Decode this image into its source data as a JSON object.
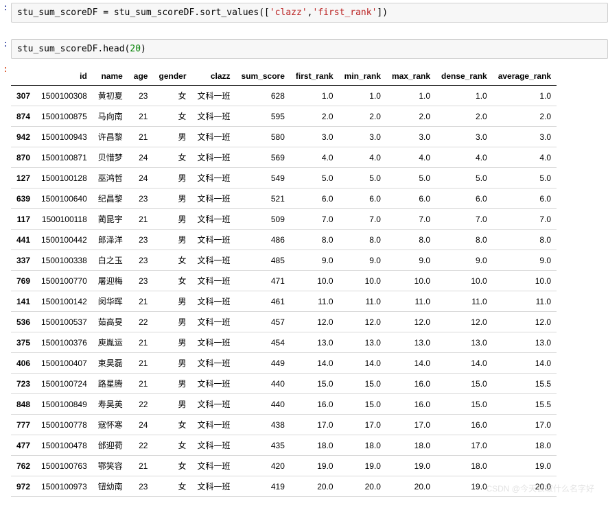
{
  "cells": {
    "code1": {
      "prompt": ":",
      "code_plain": "stu_sum_scoreDF = stu_sum_scoreDF.sort_values([",
      "str1": "'clazz'",
      "comma": ",",
      "str2": "'first_rank'",
      "end": "])"
    },
    "code2": {
      "prompt": ":",
      "code_plain": "stu_sum_scoreDF.head(",
      "num": "20",
      "end": ")"
    },
    "out_prompt": ":"
  },
  "table": {
    "columns": [
      "",
      "id",
      "name",
      "age",
      "gender",
      "clazz",
      "sum_score",
      "first_rank",
      "min_rank",
      "max_rank",
      "dense_rank",
      "average_rank"
    ],
    "rows": [
      {
        "idx": "307",
        "id": "1500100308",
        "name": "黄初夏",
        "age": "23",
        "gender": "女",
        "clazz": "文科一班",
        "sum_score": "628",
        "first_rank": "1.0",
        "min_rank": "1.0",
        "max_rank": "1.0",
        "dense_rank": "1.0",
        "average_rank": "1.0"
      },
      {
        "idx": "874",
        "id": "1500100875",
        "name": "马向南",
        "age": "21",
        "gender": "女",
        "clazz": "文科一班",
        "sum_score": "595",
        "first_rank": "2.0",
        "min_rank": "2.0",
        "max_rank": "2.0",
        "dense_rank": "2.0",
        "average_rank": "2.0"
      },
      {
        "idx": "942",
        "id": "1500100943",
        "name": "许昌黎",
        "age": "21",
        "gender": "男",
        "clazz": "文科一班",
        "sum_score": "580",
        "first_rank": "3.0",
        "min_rank": "3.0",
        "max_rank": "3.0",
        "dense_rank": "3.0",
        "average_rank": "3.0"
      },
      {
        "idx": "870",
        "id": "1500100871",
        "name": "贝惜梦",
        "age": "24",
        "gender": "女",
        "clazz": "文科一班",
        "sum_score": "569",
        "first_rank": "4.0",
        "min_rank": "4.0",
        "max_rank": "4.0",
        "dense_rank": "4.0",
        "average_rank": "4.0"
      },
      {
        "idx": "127",
        "id": "1500100128",
        "name": "巫鸿哲",
        "age": "24",
        "gender": "男",
        "clazz": "文科一班",
        "sum_score": "549",
        "first_rank": "5.0",
        "min_rank": "5.0",
        "max_rank": "5.0",
        "dense_rank": "5.0",
        "average_rank": "5.0"
      },
      {
        "idx": "639",
        "id": "1500100640",
        "name": "纪昌黎",
        "age": "23",
        "gender": "男",
        "clazz": "文科一班",
        "sum_score": "521",
        "first_rank": "6.0",
        "min_rank": "6.0",
        "max_rank": "6.0",
        "dense_rank": "6.0",
        "average_rank": "6.0"
      },
      {
        "idx": "117",
        "id": "1500100118",
        "name": "蔺昆宇",
        "age": "21",
        "gender": "男",
        "clazz": "文科一班",
        "sum_score": "509",
        "first_rank": "7.0",
        "min_rank": "7.0",
        "max_rank": "7.0",
        "dense_rank": "7.0",
        "average_rank": "7.0"
      },
      {
        "idx": "441",
        "id": "1500100442",
        "name": "郎泽洋",
        "age": "23",
        "gender": "男",
        "clazz": "文科一班",
        "sum_score": "486",
        "first_rank": "8.0",
        "min_rank": "8.0",
        "max_rank": "8.0",
        "dense_rank": "8.0",
        "average_rank": "8.0"
      },
      {
        "idx": "337",
        "id": "1500100338",
        "name": "白之玉",
        "age": "23",
        "gender": "女",
        "clazz": "文科一班",
        "sum_score": "485",
        "first_rank": "9.0",
        "min_rank": "9.0",
        "max_rank": "9.0",
        "dense_rank": "9.0",
        "average_rank": "9.0"
      },
      {
        "idx": "769",
        "id": "1500100770",
        "name": "屠迎梅",
        "age": "23",
        "gender": "女",
        "clazz": "文科一班",
        "sum_score": "471",
        "first_rank": "10.0",
        "min_rank": "10.0",
        "max_rank": "10.0",
        "dense_rank": "10.0",
        "average_rank": "10.0"
      },
      {
        "idx": "141",
        "id": "1500100142",
        "name": "闵华晖",
        "age": "21",
        "gender": "男",
        "clazz": "文科一班",
        "sum_score": "461",
        "first_rank": "11.0",
        "min_rank": "11.0",
        "max_rank": "11.0",
        "dense_rank": "11.0",
        "average_rank": "11.0"
      },
      {
        "idx": "536",
        "id": "1500100537",
        "name": "茹高旻",
        "age": "22",
        "gender": "男",
        "clazz": "文科一班",
        "sum_score": "457",
        "first_rank": "12.0",
        "min_rank": "12.0",
        "max_rank": "12.0",
        "dense_rank": "12.0",
        "average_rank": "12.0"
      },
      {
        "idx": "375",
        "id": "1500100376",
        "name": "庾胤运",
        "age": "21",
        "gender": "男",
        "clazz": "文科一班",
        "sum_score": "454",
        "first_rank": "13.0",
        "min_rank": "13.0",
        "max_rank": "13.0",
        "dense_rank": "13.0",
        "average_rank": "13.0"
      },
      {
        "idx": "406",
        "id": "1500100407",
        "name": "束昊磊",
        "age": "21",
        "gender": "男",
        "clazz": "文科一班",
        "sum_score": "449",
        "first_rank": "14.0",
        "min_rank": "14.0",
        "max_rank": "14.0",
        "dense_rank": "14.0",
        "average_rank": "14.0"
      },
      {
        "idx": "723",
        "id": "1500100724",
        "name": "路星腾",
        "age": "21",
        "gender": "男",
        "clazz": "文科一班",
        "sum_score": "440",
        "first_rank": "15.0",
        "min_rank": "15.0",
        "max_rank": "16.0",
        "dense_rank": "15.0",
        "average_rank": "15.5"
      },
      {
        "idx": "848",
        "id": "1500100849",
        "name": "寿昊英",
        "age": "22",
        "gender": "男",
        "clazz": "文科一班",
        "sum_score": "440",
        "first_rank": "16.0",
        "min_rank": "15.0",
        "max_rank": "16.0",
        "dense_rank": "15.0",
        "average_rank": "15.5"
      },
      {
        "idx": "777",
        "id": "1500100778",
        "name": "寇怀寒",
        "age": "24",
        "gender": "女",
        "clazz": "文科一班",
        "sum_score": "438",
        "first_rank": "17.0",
        "min_rank": "17.0",
        "max_rank": "17.0",
        "dense_rank": "16.0",
        "average_rank": "17.0"
      },
      {
        "idx": "477",
        "id": "1500100478",
        "name": "邰迎荷",
        "age": "22",
        "gender": "女",
        "clazz": "文科一班",
        "sum_score": "435",
        "first_rank": "18.0",
        "min_rank": "18.0",
        "max_rank": "18.0",
        "dense_rank": "17.0",
        "average_rank": "18.0"
      },
      {
        "idx": "762",
        "id": "1500100763",
        "name": "鄂笑容",
        "age": "21",
        "gender": "女",
        "clazz": "文科一班",
        "sum_score": "420",
        "first_rank": "19.0",
        "min_rank": "19.0",
        "max_rank": "19.0",
        "dense_rank": "18.0",
        "average_rank": "19.0"
      },
      {
        "idx": "972",
        "id": "1500100973",
        "name": "钮幼南",
        "age": "23",
        "gender": "女",
        "clazz": "文科一班",
        "sum_score": "419",
        "first_rank": "20.0",
        "min_rank": "20.0",
        "max_rank": "20.0",
        "dense_rank": "19.0",
        "average_rank": "20.0"
      }
    ]
  },
  "watermark": "CSDN @今天该取什么名字好"
}
